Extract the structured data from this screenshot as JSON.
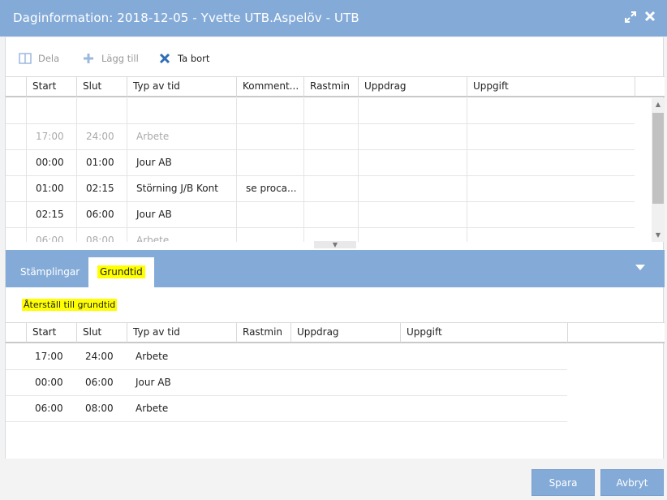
{
  "window": {
    "title": "Daginformation: 2018-12-05 - Yvette UTB.Aspelöv - UTB"
  },
  "toolbar": {
    "dela": "Dela",
    "lagg_till": "Lägg till",
    "ta_bort": "Ta bort"
  },
  "upper_table": {
    "headers": [
      "Start",
      "Slut",
      "Typ av tid",
      "Komment...",
      "Rastmin",
      "Uppdrag",
      "Uppgift"
    ],
    "rows": [
      [
        "",
        "",
        "",
        "",
        "",
        "",
        ""
      ],
      [
        "17:00",
        "24:00",
        "Arbete",
        "",
        "",
        "",
        ""
      ],
      [
        "00:00",
        "01:00",
        "Jour AB",
        "",
        "",
        "",
        ""
      ],
      [
        "01:00",
        "02:15",
        "Störning J/B Kont",
        "se proca...",
        "",
        "",
        ""
      ],
      [
        "02:15",
        "06:00",
        "Jour AB",
        "",
        "",
        "",
        ""
      ],
      [
        "06:00",
        "08:00",
        "Arbete",
        "",
        "",
        "",
        ""
      ]
    ]
  },
  "tabs": [
    {
      "label": "Stämplingar"
    },
    {
      "label": "Grundtid"
    }
  ],
  "reset_link": "Återställ till grundtid",
  "lower_table": {
    "headers": [
      "Start",
      "Slut",
      "Typ av tid",
      "Rastmin",
      "Uppdrag",
      "Uppgift"
    ],
    "rows": [
      [
        "17:00",
        "24:00",
        "Arbete",
        "",
        "",
        ""
      ],
      [
        "00:00",
        "06:00",
        "Jour AB",
        "",
        "",
        ""
      ],
      [
        "06:00",
        "08:00",
        "Arbete",
        "",
        "",
        ""
      ]
    ]
  },
  "footer": {
    "spara": "Spara",
    "avbryt": "Avbryt"
  },
  "colors": {
    "accent": "#84abd8",
    "highlight": "#ffff00"
  }
}
